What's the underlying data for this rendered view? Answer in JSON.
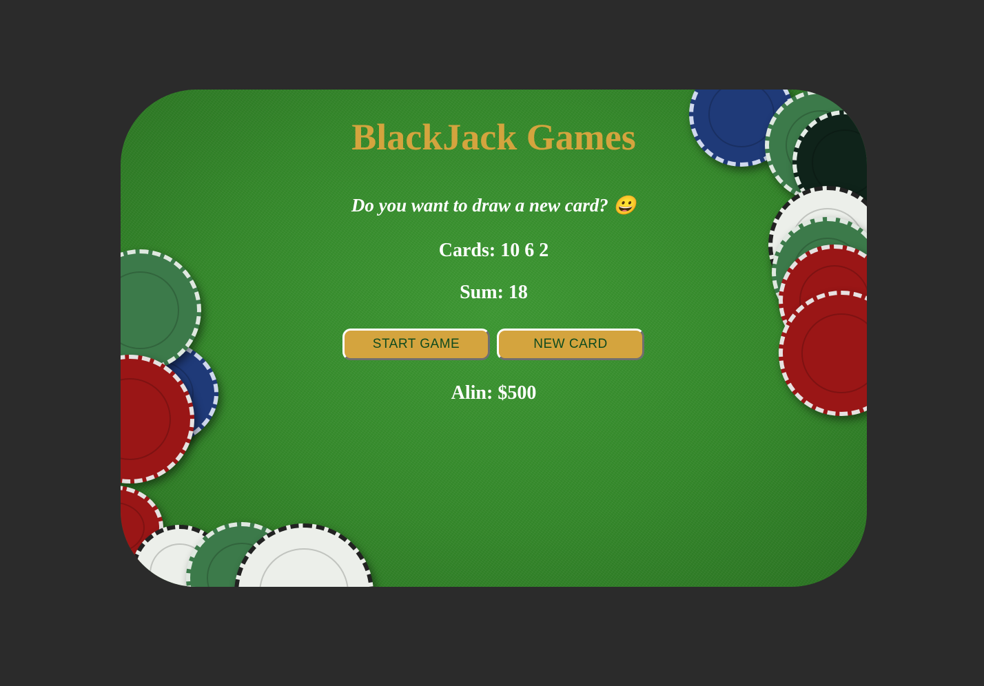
{
  "title": "BlackJack Games",
  "message": "Do you want to draw a new card? 😀",
  "cards": "Cards: 10 6 2",
  "sum": "Sum: 18",
  "buttons": {
    "start": "START GAME",
    "new_card": "NEW CARD"
  },
  "player": "Alin: $500",
  "colors": {
    "accent": "#d4a43e",
    "felt": "#368a2c",
    "background": "#2b2b2b",
    "button_text": "#0f4a1e"
  }
}
